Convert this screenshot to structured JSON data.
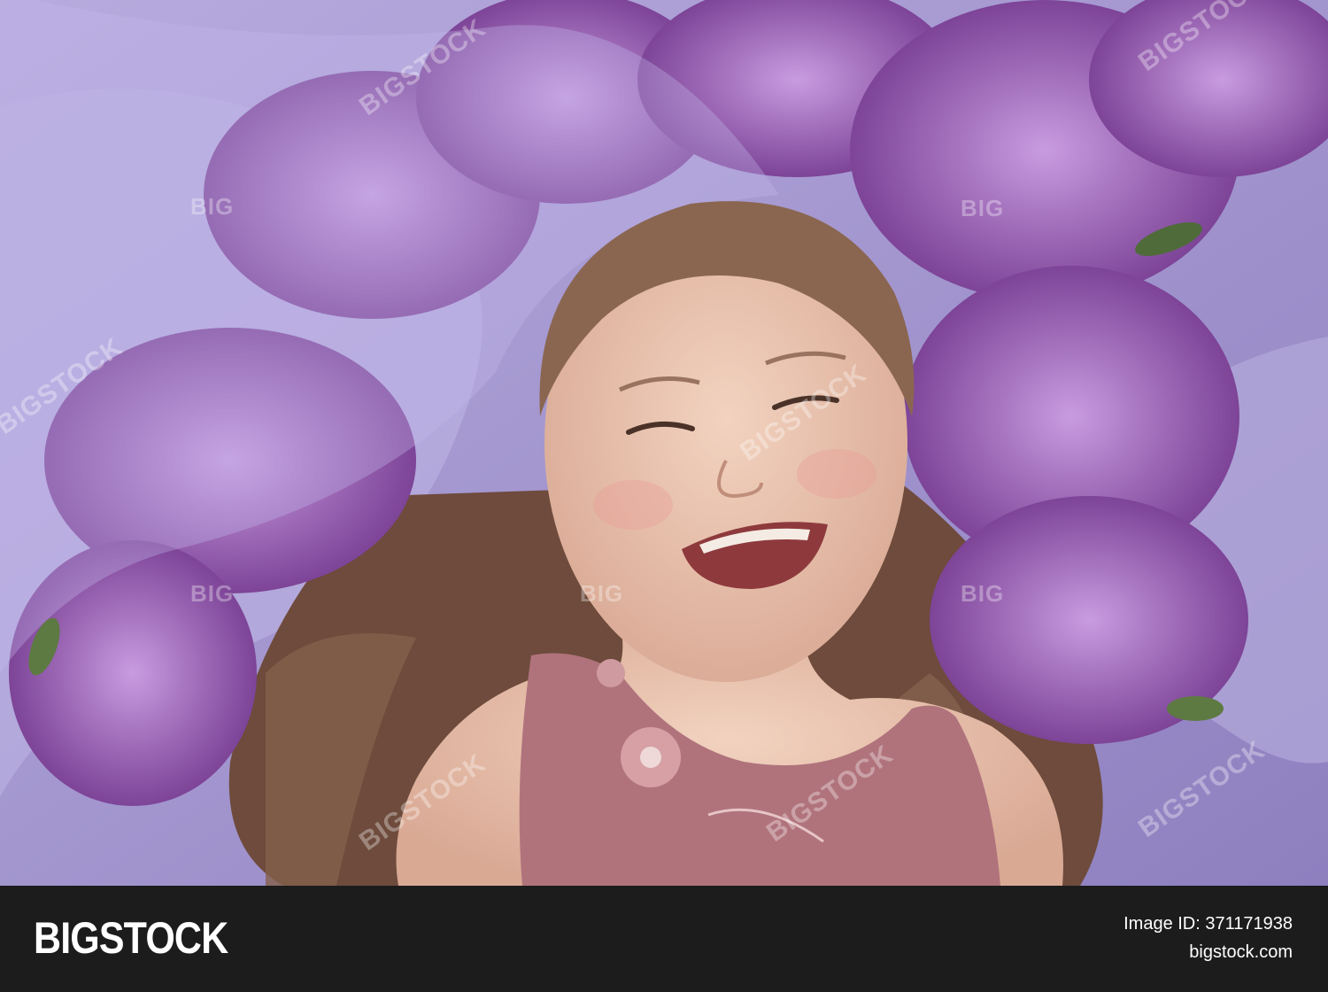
{
  "photo": {
    "subject": "Smiling girl lying among lilac flowers and lavender fabric",
    "colors": {
      "lilac_dark": "#7a3f8f",
      "lilac_mid": "#a46bc0",
      "lilac_light": "#d7b7ea",
      "fabric": "#a89bd0",
      "hair": "#6e4b3c",
      "skin": "#e9c3ae",
      "dress": "#b0737c"
    }
  },
  "watermarks": [
    "BIGSTOCK",
    "BIG"
  ],
  "footer": {
    "logo": "BIGSTOCK",
    "image_id": "Image ID: 371171938",
    "site": "bigstock.com"
  }
}
